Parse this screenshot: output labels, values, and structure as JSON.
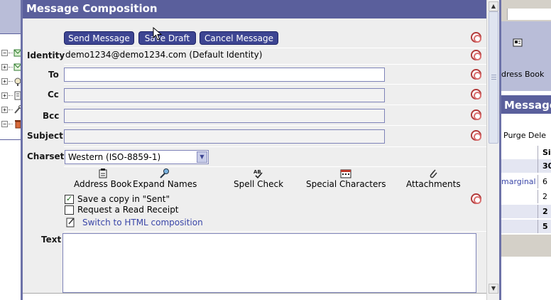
{
  "window": {
    "title": "Message Composition"
  },
  "buttons": {
    "send": "Send Message",
    "save_draft": "Save Draft",
    "cancel": "Cancel Message"
  },
  "fields": {
    "identity_label": "Identity",
    "identity_value": "demo1234@demo1234.com (Default Identity)",
    "to_label": "To",
    "to_value": "",
    "cc_label": "Cc",
    "cc_value": "",
    "bcc_label": "Bcc",
    "bcc_value": "",
    "subject_label": "Subject",
    "subject_value": "",
    "charset_label": "Charset",
    "charset_value": "Western (ISO-8859-1)",
    "text_label": "Text"
  },
  "tools": [
    {
      "label": "Address Book",
      "icon": "address-book-icon"
    },
    {
      "label": "Expand Names",
      "icon": "expand-names-icon"
    },
    {
      "label": "Spell Check",
      "icon": "spell-check-icon"
    },
    {
      "label": "Special Characters",
      "icon": "special-characters-icon"
    },
    {
      "label": "Attachments",
      "icon": "paperclip-icon"
    }
  ],
  "options": {
    "save_copy_label": "Save a copy in \"Sent\"",
    "save_copy_checked": true,
    "read_receipt_label": "Request a Read Receipt",
    "read_receipt_checked": false,
    "switch_html_label": "Switch to HTML composition"
  },
  "background": {
    "address_book_label": "dress Book",
    "messages_title": "Message",
    "toolbar_text": "Purge Dele",
    "size_header": "Siz",
    "rows": [
      {
        "c1": "",
        "c2": "30"
      },
      {
        "c1": "marginal",
        "c2": "6"
      },
      {
        "c1": "",
        "c2": "2"
      },
      {
        "c1": "",
        "c2": "2"
      },
      {
        "c1": "",
        "c2": "5"
      }
    ]
  },
  "colors": {
    "title_bar": "#5a5f9c",
    "button_bg": "#3d4592",
    "link": "#3a46a8",
    "help_icon": "#b23a3a"
  }
}
